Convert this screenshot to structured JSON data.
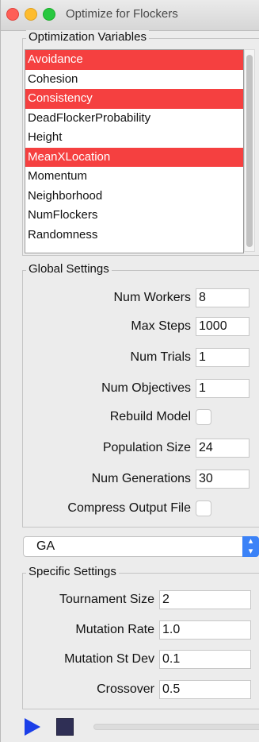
{
  "window": {
    "title": "Optimize for Flockers"
  },
  "variables": {
    "title": "Optimization Variables",
    "items": [
      {
        "label": "Avoidance",
        "selected": true
      },
      {
        "label": "Cohesion",
        "selected": false
      },
      {
        "label": "Consistency",
        "selected": true
      },
      {
        "label": "DeadFlockerProbability",
        "selected": false
      },
      {
        "label": "Height",
        "selected": false
      },
      {
        "label": "MeanXLocation",
        "selected": true
      },
      {
        "label": "Momentum",
        "selected": false
      },
      {
        "label": "Neighborhood",
        "selected": false
      },
      {
        "label": "NumFlockers",
        "selected": false
      },
      {
        "label": "Randomness",
        "selected": false
      }
    ]
  },
  "global": {
    "title": "Global Settings",
    "num_workers": {
      "label": "Num Workers",
      "value": "8"
    },
    "max_steps": {
      "label": "Max Steps",
      "value": "1000"
    },
    "num_trials": {
      "label": "Num Trials",
      "value": "1"
    },
    "num_objectives": {
      "label": "Num Objectives",
      "value": "1"
    },
    "rebuild_model": {
      "label": "Rebuild Model",
      "checked": false
    },
    "population_size": {
      "label": "Population Size",
      "value": "24"
    },
    "num_generations": {
      "label": "Num Generations",
      "value": "30"
    },
    "compress_output": {
      "label": "Compress Output File",
      "checked": false
    }
  },
  "algorithm": {
    "value": "GA",
    "arrow_glyph": "⌃⌄"
  },
  "specific": {
    "title": "Specific Settings",
    "tournament_size": {
      "label": "Tournament Size",
      "value": "2"
    },
    "mutation_rate": {
      "label": "Mutation Rate",
      "value": "1.0"
    },
    "mutation_st_dev": {
      "label": "Mutation St Dev",
      "value": "0.1"
    },
    "crossover": {
      "label": "Crossover",
      "value": "0.5"
    }
  },
  "controls": {
    "progress": 0
  },
  "colors": {
    "selection": "#f54040",
    "accent": "#3b82f7",
    "play": "#1b3fe8",
    "stop": "#2f2f55"
  }
}
